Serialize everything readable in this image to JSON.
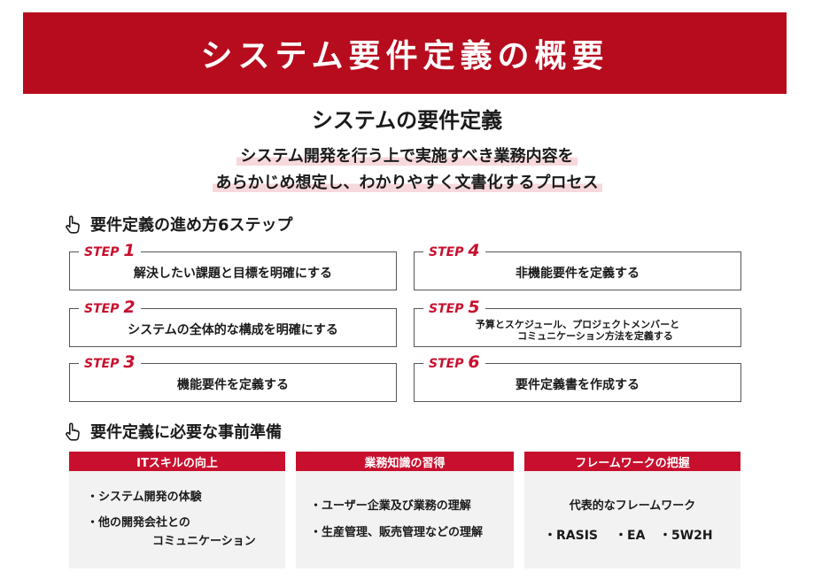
{
  "banner": {
    "title": "システム要件定義の概要"
  },
  "subtitle": "システムの要件定義",
  "lead": {
    "line1": "システム開発を行う上で実施すべき業務内容を",
    "line2": "あらかじめ想定し、わかりやすく文書化するプロセス"
  },
  "steps_section": {
    "icon": "pointing-hand-icon",
    "heading": "要件定義の進め方6ステップ"
  },
  "steps": [
    {
      "prefix": "STEP",
      "num": "1",
      "text": "解決したい課題と目標を明確にする"
    },
    {
      "prefix": "STEP",
      "num": "2",
      "text": "システムの全体的な構成を明確にする"
    },
    {
      "prefix": "STEP",
      "num": "3",
      "text": "機能要件を定義する"
    },
    {
      "prefix": "STEP",
      "num": "4",
      "text": "非機能要件を定義する"
    },
    {
      "prefix": "STEP",
      "num": "5",
      "text_line1": "予算とスケジュール、プロジェクトメンバーと",
      "text_line2": "コミュニケーション方法を定義する"
    },
    {
      "prefix": "STEP",
      "num": "6",
      "text": "要件定義書を作成する"
    }
  ],
  "prep_section": {
    "icon": "pointing-hand-icon",
    "heading": "要件定義に必要な事前準備"
  },
  "cards": [
    {
      "title": "ITスキルの向上",
      "items": [
        "・システム開発の体験",
        "・他の開発会社との",
        "コミュニケーション"
      ]
    },
    {
      "title": "業務知識の習得",
      "items": [
        "・ユーザー企業及び業務の理解",
        "・生産管理、販売管理などの理解"
      ]
    },
    {
      "title": "フレームワークの把握",
      "intro": "代表的なフレームワーク",
      "items": [
        "・RASIS",
        "・EA",
        "・5W2H"
      ]
    }
  ],
  "colors": {
    "banner": "#b70c1d",
    "accent": "#c8102e",
    "highlight": "#f7d8dc",
    "card_bg": "#f2f2f2"
  }
}
